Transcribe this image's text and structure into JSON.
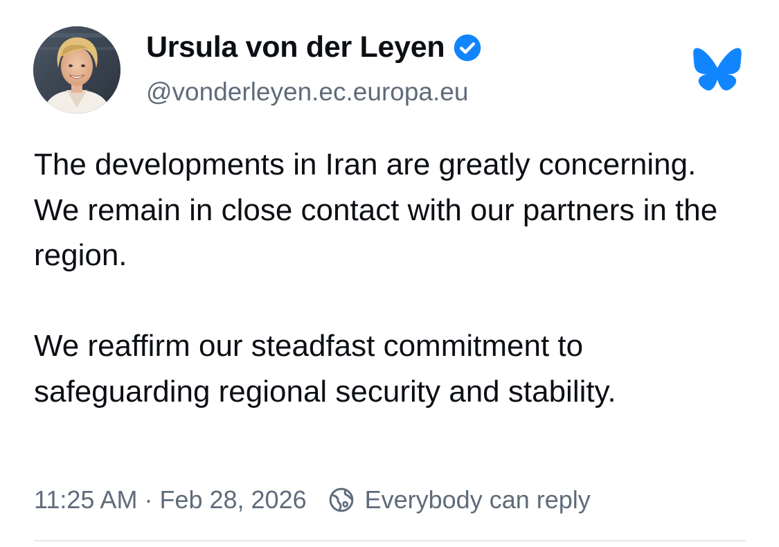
{
  "author": {
    "name": "Ursula von der Leyen",
    "handle": "@vonderleyen.ec.europa.eu",
    "verified_icon": "verified-badge-icon",
    "avatar_icon": "user-avatar-photo"
  },
  "app": {
    "logo_icon": "bluesky-butterfly-icon",
    "brand_color": "#1185fe"
  },
  "post": {
    "paragraphs": [
      "The developments in Iran are greatly concerning. We remain in close contact with our partners in the region.",
      "We reaffirm our steadfast commitment to safeguarding regional security and stability."
    ],
    "time": "11:25 AM",
    "separator": "·",
    "date": "Feb 28, 2026",
    "reply_setting_icon": "globe-icon",
    "reply_setting": "Everybody can reply"
  },
  "colors": {
    "text": "#0b0f14",
    "secondary_text": "#5f6b7a",
    "divider": "#e3e7ec",
    "verified": "#1185fe"
  }
}
